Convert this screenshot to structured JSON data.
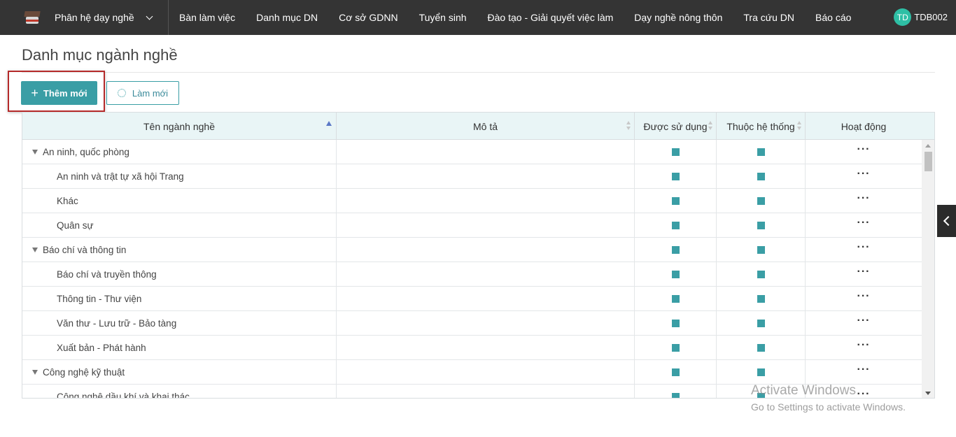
{
  "topbar": {
    "logo_icon": "graduation-book-icon",
    "module_label": "Phân hệ dạy nghề",
    "nav": [
      "Bàn làm việc",
      "Danh mục DN",
      "Cơ sở GDNN",
      "Tuyển sinh",
      "Đào tạo - Giải quyết việc làm",
      "Dạy nghề nông thôn",
      "Tra cứu DN",
      "Báo cáo"
    ],
    "user": {
      "initials": "TD",
      "username": "TDB002"
    }
  },
  "page": {
    "title": "Danh mục ngành nghề",
    "add_button": "Thêm mới",
    "refresh_button": "Làm mới"
  },
  "table": {
    "columns": [
      "Tên ngành nghề",
      "Mô tả",
      "Được sử dụng",
      "Thuộc hệ thống",
      "Hoạt động"
    ],
    "action_label": "···",
    "rows": [
      {
        "name": "An ninh, quốc phòng",
        "level": 0
      },
      {
        "name": "An ninh và trật tự xã hội Trang",
        "level": 1
      },
      {
        "name": "Khác",
        "level": 1
      },
      {
        "name": "Quân sự",
        "level": 1
      },
      {
        "name": "Báo chí và thông tin",
        "level": 0
      },
      {
        "name": "Báo chí và truyền thông",
        "level": 1
      },
      {
        "name": "Thông tin - Thư viện",
        "level": 1
      },
      {
        "name": "Văn thư - Lưu trữ - Bảo tàng",
        "level": 1
      },
      {
        "name": "Xuất bản - Phát hành",
        "level": 1
      },
      {
        "name": "Công nghệ kỹ thuật",
        "level": 0
      },
      {
        "name": "Công nghệ dầu khí và khai thác",
        "level": 1
      }
    ]
  },
  "watermark": {
    "line1": "Activate Windows",
    "line2": "Go to Settings to activate Windows."
  },
  "colors": {
    "accent": "#3a9ea5",
    "navbar": "#343434",
    "highlight": "#b52a2a"
  }
}
